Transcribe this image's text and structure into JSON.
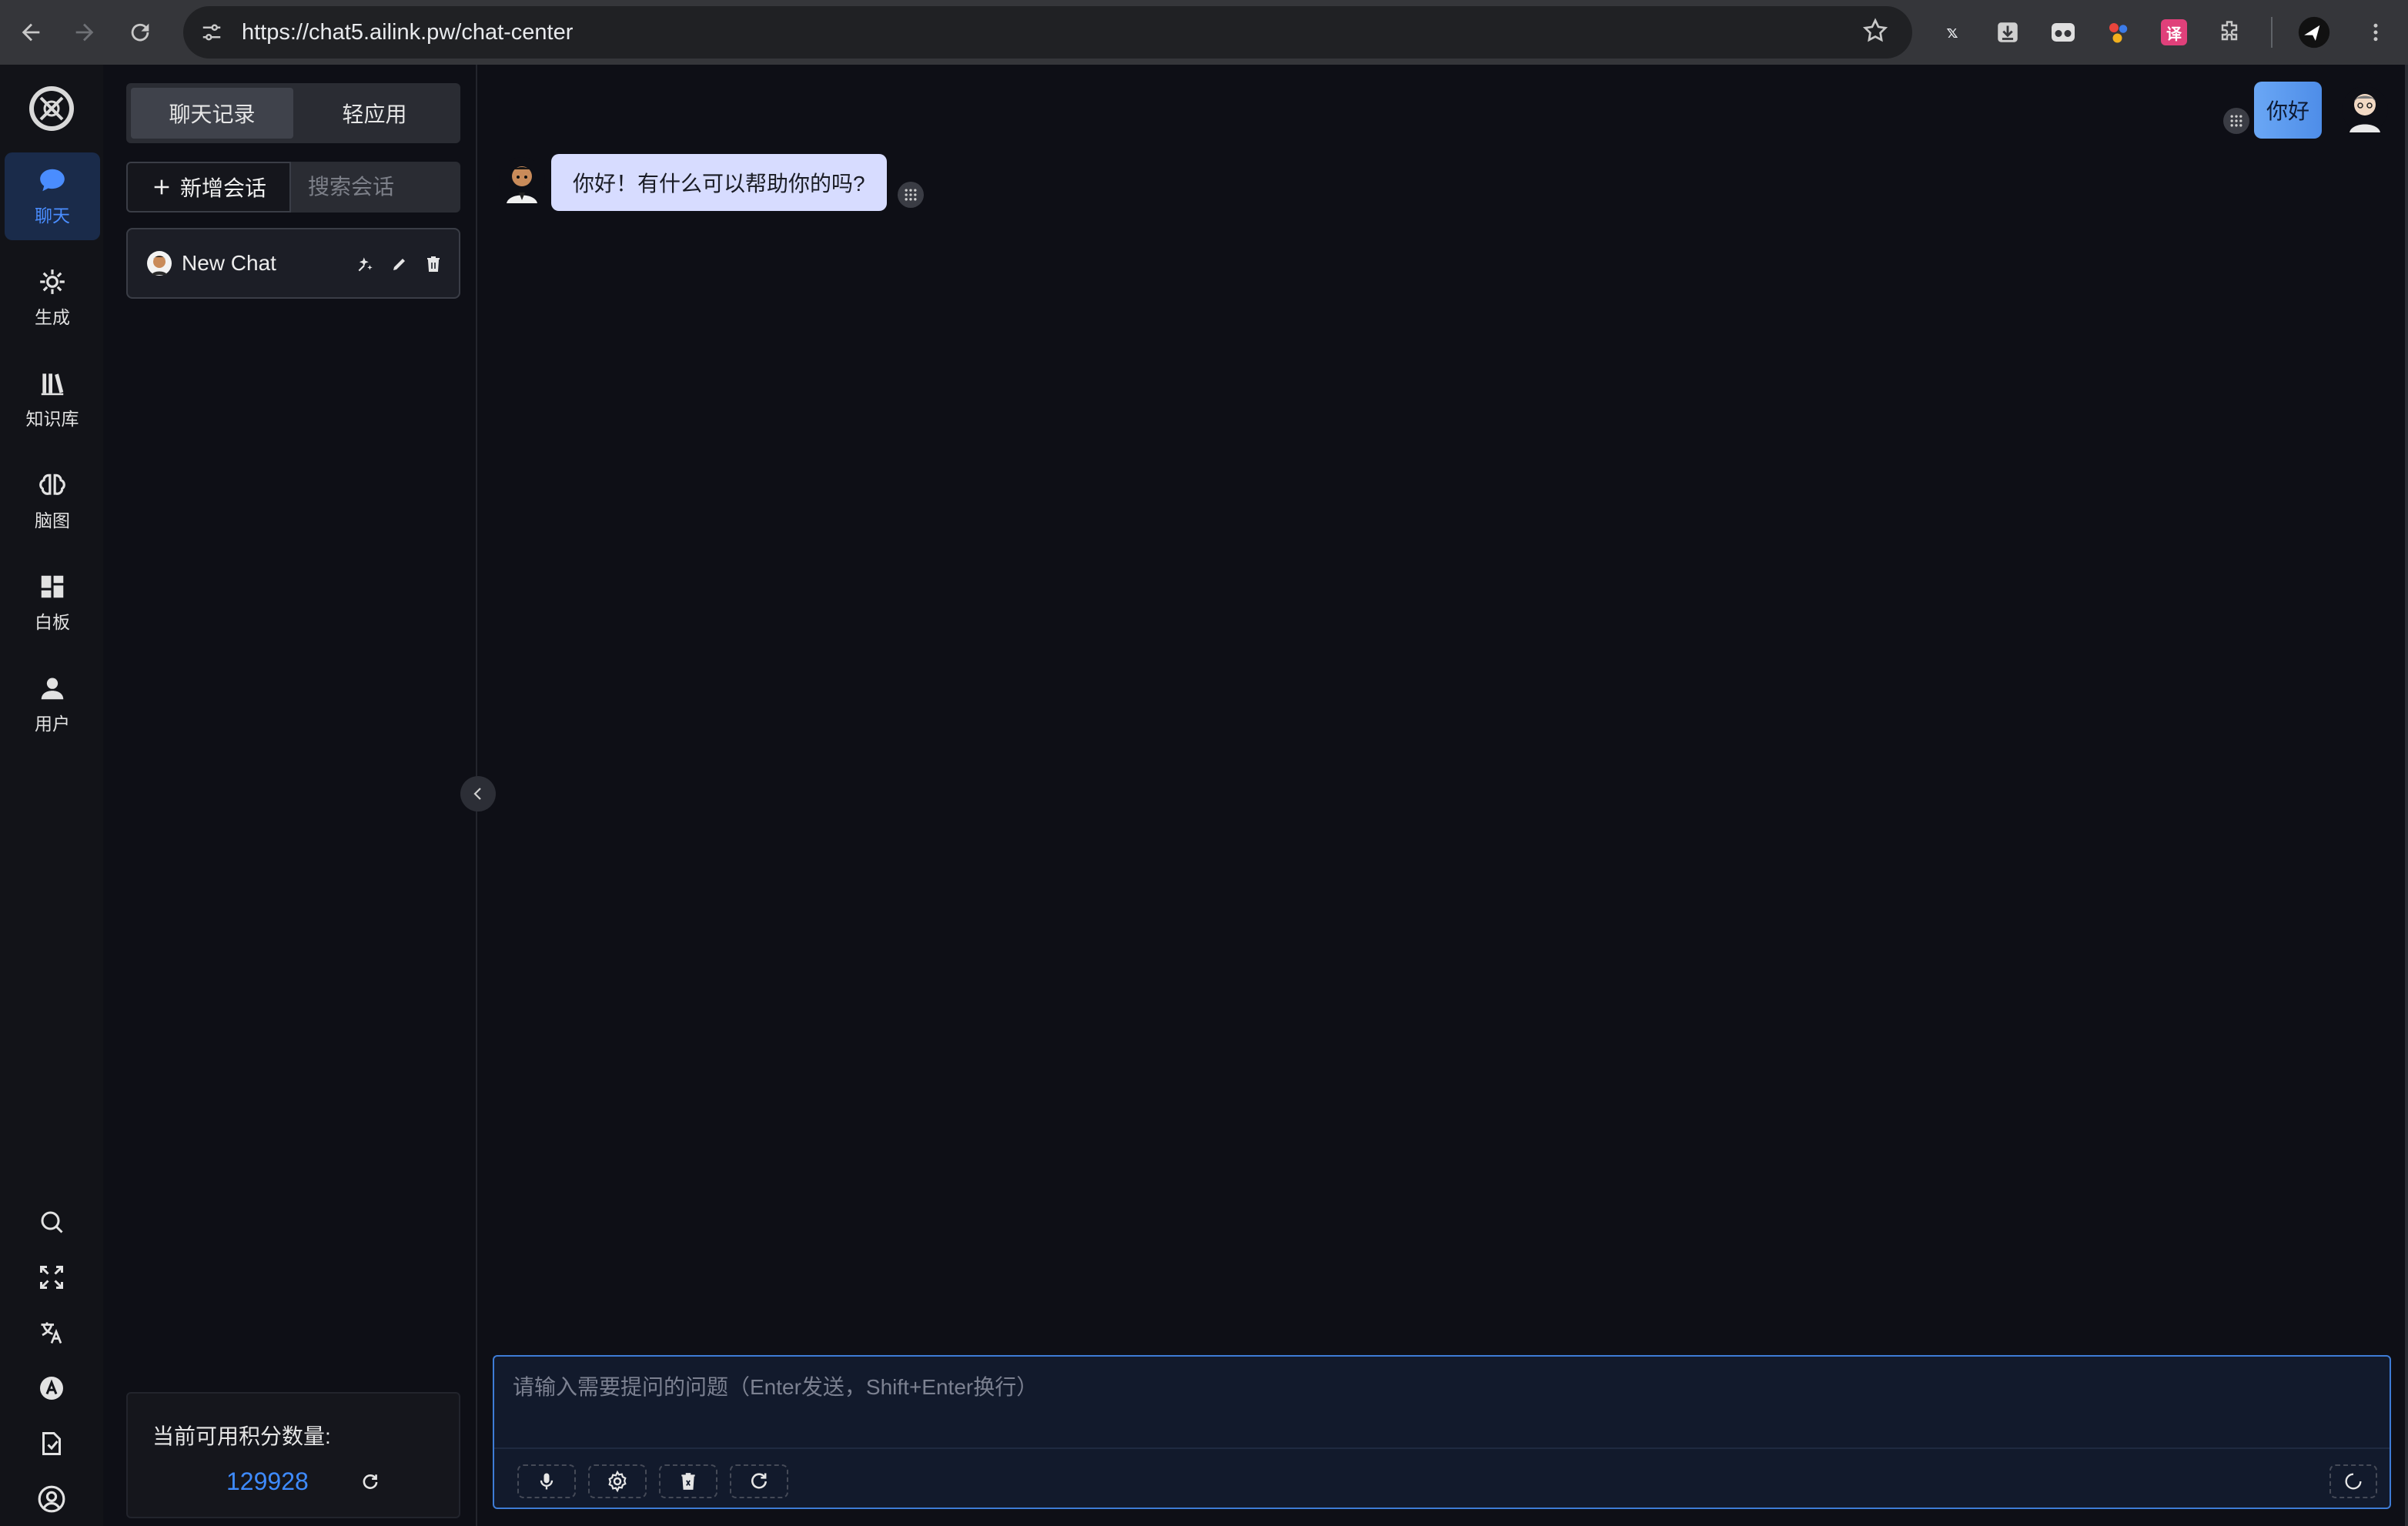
{
  "browser": {
    "url": "https://chat5.ailink.pw/chat-center"
  },
  "rail": {
    "items": [
      {
        "label": "聊天",
        "icon": "chat-bubble-icon",
        "active": true
      },
      {
        "label": "生成",
        "icon": "sparkle-gear-icon"
      },
      {
        "label": "知识库",
        "icon": "books-icon"
      },
      {
        "label": "脑图",
        "icon": "brain-icon"
      },
      {
        "label": "白板",
        "icon": "dashboard-icon"
      },
      {
        "label": "用户",
        "icon": "user-icon"
      }
    ],
    "tools": [
      "search-icon",
      "fullscreen-icon",
      "translate-icon",
      "font-a-icon",
      "document-icon",
      "account-circle-icon"
    ]
  },
  "panel": {
    "tabs": [
      "聊天记录",
      "轻应用"
    ],
    "new_chat_label": "新增会话",
    "search_placeholder": "搜索会话",
    "chats": [
      {
        "title": "New Chat"
      }
    ],
    "credits_label": "当前可用积分数量:",
    "credits_value": "129928"
  },
  "messages": [
    {
      "role": "user",
      "text": "你好"
    },
    {
      "role": "assistant",
      "text": "你好！有什么可以帮助你的吗?"
    }
  ],
  "composer": {
    "placeholder": "请输入需要提问的问题（Enter发送，Shift+Enter换行）",
    "tools": [
      "microphone-icon",
      "settings-icon",
      "clear-icon",
      "refresh-icon"
    ]
  },
  "colors": {
    "accent": "#3e8bff",
    "background": "#0e0f16",
    "bot_bubble": "#d7dcff",
    "user_bubble": "#4e8de8"
  }
}
